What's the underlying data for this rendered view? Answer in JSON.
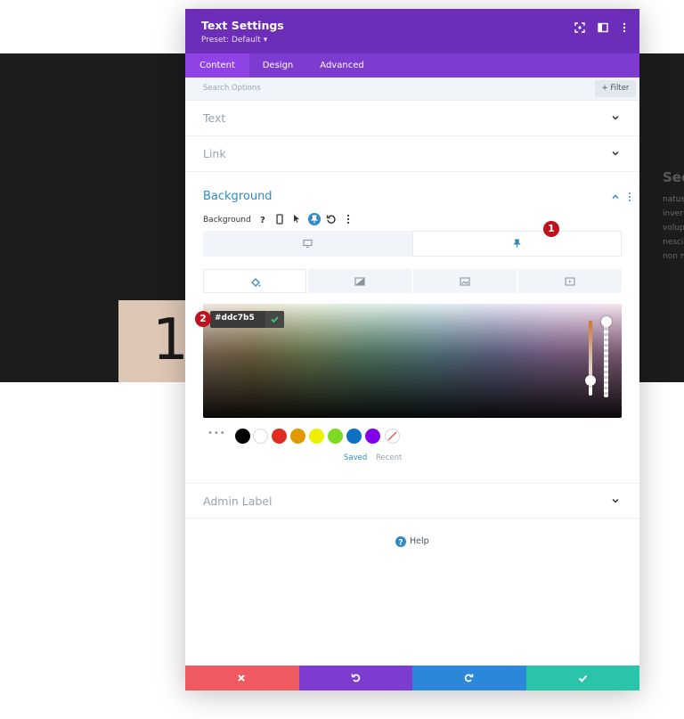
{
  "background_page": {
    "number": "1",
    "heading": "Sec",
    "body_lines": [
      "natus",
      "inver",
      "volup",
      "nesci",
      "non n"
    ]
  },
  "modal": {
    "title": "Text Settings",
    "preset": "Preset: Default ▾",
    "tabs": [
      {
        "label": "Content",
        "active": true
      },
      {
        "label": "Design",
        "active": false
      },
      {
        "label": "Advanced",
        "active": false
      }
    ],
    "search": {
      "placeholder": "Search Options"
    },
    "filter_label": "Filter",
    "sections": [
      {
        "title": "Text"
      },
      {
        "title": "Link"
      }
    ],
    "background": {
      "title": "Background",
      "field_label": "Background",
      "hex_value": "#ddc7b5",
      "selected_color": "#ddc7b5",
      "swatches": [
        "#000000",
        "#ffffff",
        "#e02b20",
        "#e09900",
        "#edf000",
        "#7cda24",
        "#0c71c3",
        "#8300e9"
      ],
      "swatch_tabs": [
        {
          "label": "Saved",
          "active": true
        },
        {
          "label": "Recent",
          "active": false
        }
      ]
    },
    "admin_label": {
      "title": "Admin Label"
    },
    "help_label": "Help",
    "footer_colors": {
      "cancel": "#ee5a5f",
      "undo": "#7d3bcf",
      "redo": "#2b87da",
      "save": "#29c4a9"
    }
  },
  "annotations": [
    "1",
    "2"
  ],
  "colors": {
    "header": "#6c2eb9",
    "tabs": "#7e3bd0",
    "accent_blue": "#2f8ac6"
  }
}
